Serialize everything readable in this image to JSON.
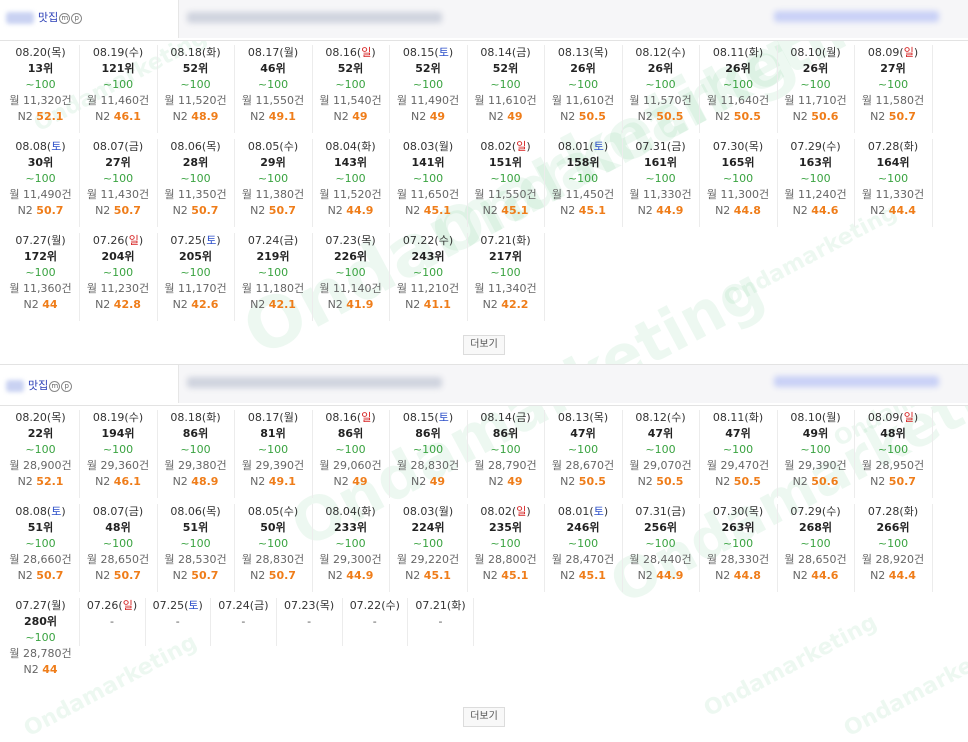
{
  "watermark": "Ondamarketing",
  "sections": [
    {
      "keyword": "맛집",
      "badge_m": "m",
      "badge_p": "p",
      "more_label": "더보기",
      "rows": [
        [
          {
            "date": "08.20",
            "day": "목",
            "rank": "13위",
            "range": "~100",
            "monthly": "월 11,320건",
            "n2_label": "N2",
            "n2_value": "52.1"
          },
          {
            "date": "08.19",
            "day": "수",
            "rank": "121위",
            "range": "~100",
            "monthly": "월 11,460건",
            "n2_label": "N2",
            "n2_value": "46.1"
          },
          {
            "date": "08.18",
            "day": "화",
            "rank": "52위",
            "range": "~100",
            "monthly": "월 11,520건",
            "n2_label": "N2",
            "n2_value": "48.9"
          },
          {
            "date": "08.17",
            "day": "월",
            "rank": "46위",
            "range": "~100",
            "monthly": "월 11,550건",
            "n2_label": "N2",
            "n2_value": "49.1"
          },
          {
            "date": "08.16",
            "day": "일",
            "rank": "52위",
            "range": "~100",
            "monthly": "월 11,540건",
            "n2_label": "N2",
            "n2_value": "49"
          },
          {
            "date": "08.15",
            "day": "토",
            "rank": "52위",
            "range": "~100",
            "monthly": "월 11,490건",
            "n2_label": "N2",
            "n2_value": "49"
          },
          {
            "date": "08.14",
            "day": "금",
            "rank": "52위",
            "range": "~100",
            "monthly": "월 11,610건",
            "n2_label": "N2",
            "n2_value": "49"
          },
          {
            "date": "08.13",
            "day": "목",
            "rank": "26위",
            "range": "~100",
            "monthly": "월 11,610건",
            "n2_label": "N2",
            "n2_value": "50.5"
          },
          {
            "date": "08.12",
            "day": "수",
            "rank": "26위",
            "range": "~100",
            "monthly": "월 11,570건",
            "n2_label": "N2",
            "n2_value": "50.5"
          },
          {
            "date": "08.11",
            "day": "화",
            "rank": "26위",
            "range": "~100",
            "monthly": "월 11,640건",
            "n2_label": "N2",
            "n2_value": "50.5"
          },
          {
            "date": "08.10",
            "day": "월",
            "rank": "26위",
            "range": "~100",
            "monthly": "월 11,710건",
            "n2_label": "N2",
            "n2_value": "50.6"
          },
          {
            "date": "08.09",
            "day": "일",
            "rank": "27위",
            "range": "~100",
            "monthly": "월 11,580건",
            "n2_label": "N2",
            "n2_value": "50.7"
          }
        ],
        [
          {
            "date": "08.08",
            "day": "토",
            "rank": "30위",
            "range": "~100",
            "monthly": "월 11,490건",
            "n2_label": "N2",
            "n2_value": "50.7"
          },
          {
            "date": "08.07",
            "day": "금",
            "rank": "27위",
            "range": "~100",
            "monthly": "월 11,430건",
            "n2_label": "N2",
            "n2_value": "50.7"
          },
          {
            "date": "08.06",
            "day": "목",
            "rank": "28위",
            "range": "~100",
            "monthly": "월 11,350건",
            "n2_label": "N2",
            "n2_value": "50.7"
          },
          {
            "date": "08.05",
            "day": "수",
            "rank": "29위",
            "range": "~100",
            "monthly": "월 11,380건",
            "n2_label": "N2",
            "n2_value": "50.7"
          },
          {
            "date": "08.04",
            "day": "화",
            "rank": "143위",
            "range": "~100",
            "monthly": "월 11,520건",
            "n2_label": "N2",
            "n2_value": "44.9"
          },
          {
            "date": "08.03",
            "day": "월",
            "rank": "141위",
            "range": "~100",
            "monthly": "월 11,650건",
            "n2_label": "N2",
            "n2_value": "45.1"
          },
          {
            "date": "08.02",
            "day": "일",
            "rank": "151위",
            "range": "~100",
            "monthly": "월 11,550건",
            "n2_label": "N2",
            "n2_value": "45.1"
          },
          {
            "date": "08.01",
            "day": "토",
            "rank": "158위",
            "range": "~100",
            "monthly": "월 11,450건",
            "n2_label": "N2",
            "n2_value": "45.1"
          },
          {
            "date": "07.31",
            "day": "금",
            "rank": "161위",
            "range": "~100",
            "monthly": "월 11,330건",
            "n2_label": "N2",
            "n2_value": "44.9"
          },
          {
            "date": "07.30",
            "day": "목",
            "rank": "165위",
            "range": "~100",
            "monthly": "월 11,300건",
            "n2_label": "N2",
            "n2_value": "44.8"
          },
          {
            "date": "07.29",
            "day": "수",
            "rank": "163위",
            "range": "~100",
            "monthly": "월 11,240건",
            "n2_label": "N2",
            "n2_value": "44.6"
          },
          {
            "date": "07.28",
            "day": "화",
            "rank": "164위",
            "range": "~100",
            "monthly": "월 11,330건",
            "n2_label": "N2",
            "n2_value": "44.4"
          }
        ],
        [
          {
            "date": "07.27",
            "day": "월",
            "rank": "172위",
            "range": "~100",
            "monthly": "월 11,360건",
            "n2_label": "N2",
            "n2_value": "44"
          },
          {
            "date": "07.26",
            "day": "일",
            "rank": "204위",
            "range": "~100",
            "monthly": "월 11,230건",
            "n2_label": "N2",
            "n2_value": "42.8"
          },
          {
            "date": "07.25",
            "day": "토",
            "rank": "205위",
            "range": "~100",
            "monthly": "월 11,170건",
            "n2_label": "N2",
            "n2_value": "42.6"
          },
          {
            "date": "07.24",
            "day": "금",
            "rank": "219위",
            "range": "~100",
            "monthly": "월 11,180건",
            "n2_label": "N2",
            "n2_value": "42.1"
          },
          {
            "date": "07.23",
            "day": "목",
            "rank": "226위",
            "range": "~100",
            "monthly": "월 11,140건",
            "n2_label": "N2",
            "n2_value": "41.9"
          },
          {
            "date": "07.22",
            "day": "수",
            "rank": "243위",
            "range": "~100",
            "monthly": "월 11,210건",
            "n2_label": "N2",
            "n2_value": "41.1"
          },
          {
            "date": "07.21",
            "day": "화",
            "rank": "217위",
            "range": "~100",
            "monthly": "월 11,340건",
            "n2_label": "N2",
            "n2_value": "42.2"
          }
        ]
      ]
    },
    {
      "keyword": "맛집",
      "badge_m": "m",
      "badge_p": "p",
      "more_label": "더보기",
      "rows": [
        [
          {
            "date": "08.20",
            "day": "목",
            "rank": "22위",
            "range": "~100",
            "monthly": "월 28,900건",
            "n2_label": "N2",
            "n2_value": "52.1"
          },
          {
            "date": "08.19",
            "day": "수",
            "rank": "194위",
            "range": "~100",
            "monthly": "월 29,360건",
            "n2_label": "N2",
            "n2_value": "46.1"
          },
          {
            "date": "08.18",
            "day": "화",
            "rank": "86위",
            "range": "~100",
            "monthly": "월 29,380건",
            "n2_label": "N2",
            "n2_value": "48.9"
          },
          {
            "date": "08.17",
            "day": "월",
            "rank": "81위",
            "range": "~100",
            "monthly": "월 29,390건",
            "n2_label": "N2",
            "n2_value": "49.1"
          },
          {
            "date": "08.16",
            "day": "일",
            "rank": "86위",
            "range": "~100",
            "monthly": "월 29,060건",
            "n2_label": "N2",
            "n2_value": "49"
          },
          {
            "date": "08.15",
            "day": "토",
            "rank": "86위",
            "range": "~100",
            "monthly": "월 28,830건",
            "n2_label": "N2",
            "n2_value": "49"
          },
          {
            "date": "08.14",
            "day": "금",
            "rank": "86위",
            "range": "~100",
            "monthly": "월 28,790건",
            "n2_label": "N2",
            "n2_value": "49"
          },
          {
            "date": "08.13",
            "day": "목",
            "rank": "47위",
            "range": "~100",
            "monthly": "월 28,670건",
            "n2_label": "N2",
            "n2_value": "50.5"
          },
          {
            "date": "08.12",
            "day": "수",
            "rank": "47위",
            "range": "~100",
            "monthly": "월 29,070건",
            "n2_label": "N2",
            "n2_value": "50.5"
          },
          {
            "date": "08.11",
            "day": "화",
            "rank": "47위",
            "range": "~100",
            "monthly": "월 29,470건",
            "n2_label": "N2",
            "n2_value": "50.5"
          },
          {
            "date": "08.10",
            "day": "월",
            "rank": "49위",
            "range": "~100",
            "monthly": "월 29,390건",
            "n2_label": "N2",
            "n2_value": "50.6"
          },
          {
            "date": "08.09",
            "day": "일",
            "rank": "48위",
            "range": "~100",
            "monthly": "월 28,950건",
            "n2_label": "N2",
            "n2_value": "50.7"
          }
        ],
        [
          {
            "date": "08.08",
            "day": "토",
            "rank": "51위",
            "range": "~100",
            "monthly": "월 28,660건",
            "n2_label": "N2",
            "n2_value": "50.7"
          },
          {
            "date": "08.07",
            "day": "금",
            "rank": "48위",
            "range": "~100",
            "monthly": "월 28,650건",
            "n2_label": "N2",
            "n2_value": "50.7"
          },
          {
            "date": "08.06",
            "day": "목",
            "rank": "51위",
            "range": "~100",
            "monthly": "월 28,530건",
            "n2_label": "N2",
            "n2_value": "50.7"
          },
          {
            "date": "08.05",
            "day": "수",
            "rank": "50위",
            "range": "~100",
            "monthly": "월 28,830건",
            "n2_label": "N2",
            "n2_value": "50.7"
          },
          {
            "date": "08.04",
            "day": "화",
            "rank": "233위",
            "range": "~100",
            "monthly": "월 29,300건",
            "n2_label": "N2",
            "n2_value": "44.9"
          },
          {
            "date": "08.03",
            "day": "월",
            "rank": "224위",
            "range": "~100",
            "monthly": "월 29,220건",
            "n2_label": "N2",
            "n2_value": "45.1"
          },
          {
            "date": "08.02",
            "day": "일",
            "rank": "235위",
            "range": "~100",
            "monthly": "월 28,800건",
            "n2_label": "N2",
            "n2_value": "45.1"
          },
          {
            "date": "08.01",
            "day": "토",
            "rank": "246위",
            "range": "~100",
            "monthly": "월 28,470건",
            "n2_label": "N2",
            "n2_value": "45.1"
          },
          {
            "date": "07.31",
            "day": "금",
            "rank": "256위",
            "range": "~100",
            "monthly": "월 28,440건",
            "n2_label": "N2",
            "n2_value": "44.9"
          },
          {
            "date": "07.30",
            "day": "목",
            "rank": "263위",
            "range": "~100",
            "monthly": "월 28,330건",
            "n2_label": "N2",
            "n2_value": "44.8"
          },
          {
            "date": "07.29",
            "day": "수",
            "rank": "268위",
            "range": "~100",
            "monthly": "월 28,650건",
            "n2_label": "N2",
            "n2_value": "44.6"
          },
          {
            "date": "07.28",
            "day": "화",
            "rank": "266위",
            "range": "~100",
            "monthly": "월 28,920건",
            "n2_label": "N2",
            "n2_value": "44.4"
          }
        ],
        [
          {
            "date": "07.27",
            "day": "월",
            "rank": "280위",
            "range": "~100",
            "monthly": "월 28,780건",
            "n2_label": "N2",
            "n2_value": "44"
          },
          {
            "date": "07.26",
            "day": "일",
            "empty": "-"
          },
          {
            "date": "07.25",
            "day": "토",
            "empty": "-"
          },
          {
            "date": "07.24",
            "day": "금",
            "empty": "-"
          },
          {
            "date": "07.23",
            "day": "목",
            "empty": "-"
          },
          {
            "date": "07.22",
            "day": "수",
            "empty": "-"
          },
          {
            "date": "07.21",
            "day": "화",
            "empty": "-"
          }
        ]
      ]
    }
  ]
}
